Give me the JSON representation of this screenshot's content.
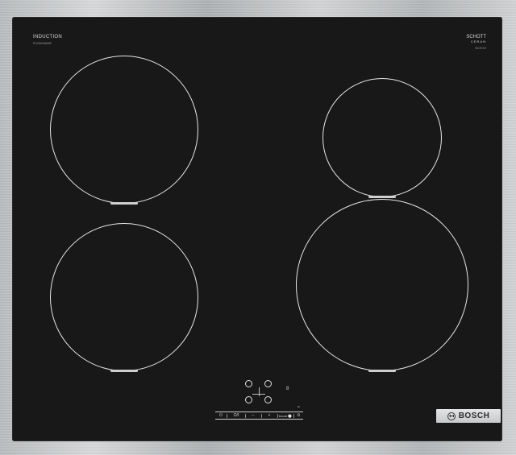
{
  "cooktop": {
    "induction_label": "INDUCTION",
    "induction_model": "PUG61RAB5E",
    "schott_label": "SCHOTT",
    "ceran_label": "CERAN",
    "ceran_model": "S6.9X1E"
  },
  "controls": {
    "power": "⏻",
    "on_off": "O/I",
    "minus": "−",
    "plus": "+",
    "boost": "boost ⚪",
    "timer": "⏲",
    "indicator": "8",
    "small_mark": "Hi"
  },
  "brand": {
    "name": "BOSCH"
  },
  "cooking_zones": [
    {
      "name": "front-left"
    },
    {
      "name": "rear-left"
    },
    {
      "name": "rear-right"
    },
    {
      "name": "front-right"
    }
  ]
}
